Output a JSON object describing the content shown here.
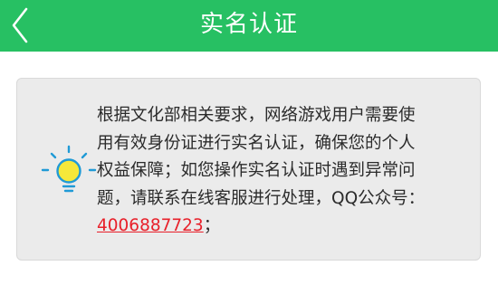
{
  "header": {
    "title": "实名认证",
    "back_icon": "chevron-left-icon",
    "background": "#27c063"
  },
  "notice": {
    "icon": "lightbulb-icon",
    "lines": [
      "根据文化部相关要求，网络游戏用户需要使",
      "用有效身份证进行实名认证，确保您的个人",
      "权益保障；如您操作实名认证时遇到异常问",
      "题，请联系在线客服进行处理，QQ公众号："
    ],
    "qq_number": "4006887723",
    "tail": "；",
    "link_color": "#e8202a"
  }
}
